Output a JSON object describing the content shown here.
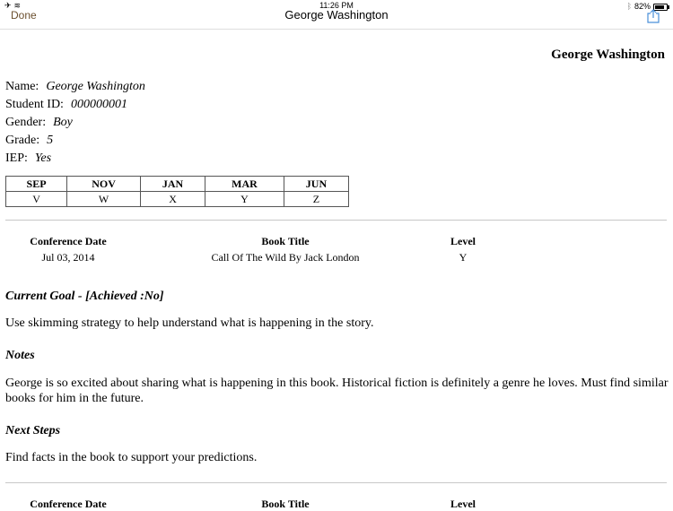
{
  "status_bar": {
    "airplane_icon": "airplane-icon",
    "wifi_icon": "wifi-icon",
    "time": "11:26 PM",
    "bluetooth_icon": "bluetooth-icon",
    "battery": "82%",
    "battery_level": 0.82
  },
  "nav": {
    "done_label": "Done",
    "title": "George Washington",
    "share_icon": "share-icon",
    "accent_color": "#6b4f2e"
  },
  "student": {
    "header_name": "George Washington",
    "fields": [
      {
        "label": "Name:",
        "value": "George Washington"
      },
      {
        "label": "Student ID:",
        "value": "000000001"
      },
      {
        "label": "Gender:",
        "value": "Boy"
      },
      {
        "label": "Grade:",
        "value": "5"
      },
      {
        "label": "IEP:",
        "value": "Yes"
      }
    ]
  },
  "levels_table": {
    "headers": [
      "SEP",
      "NOV",
      "JAN",
      "MAR",
      "JUN"
    ],
    "values": [
      "V",
      "W",
      "X",
      "Y",
      "Z"
    ]
  },
  "conference": {
    "headers": {
      "date": "Conference Date",
      "book": "Book Title",
      "level": "Level"
    },
    "date": "Jul 03, 2014",
    "book": "Call Of The Wild By Jack London",
    "level": "Y"
  },
  "current_goal": {
    "title": "Current Goal - [Achieved :No]",
    "text": "Use skimming strategy to help understand what is happening in the story."
  },
  "notes": {
    "title": "Notes",
    "text": "George is so excited about sharing what is happening in this book. Historical fiction is definitely a genre he loves. Must find similar books for him in the future."
  },
  "next_steps": {
    "title": "Next Steps",
    "text": "Find facts in the book to support your predictions."
  },
  "next_conference": {
    "headers": {
      "date": "Conference Date",
      "book": "Book Title",
      "level": "Level"
    }
  }
}
